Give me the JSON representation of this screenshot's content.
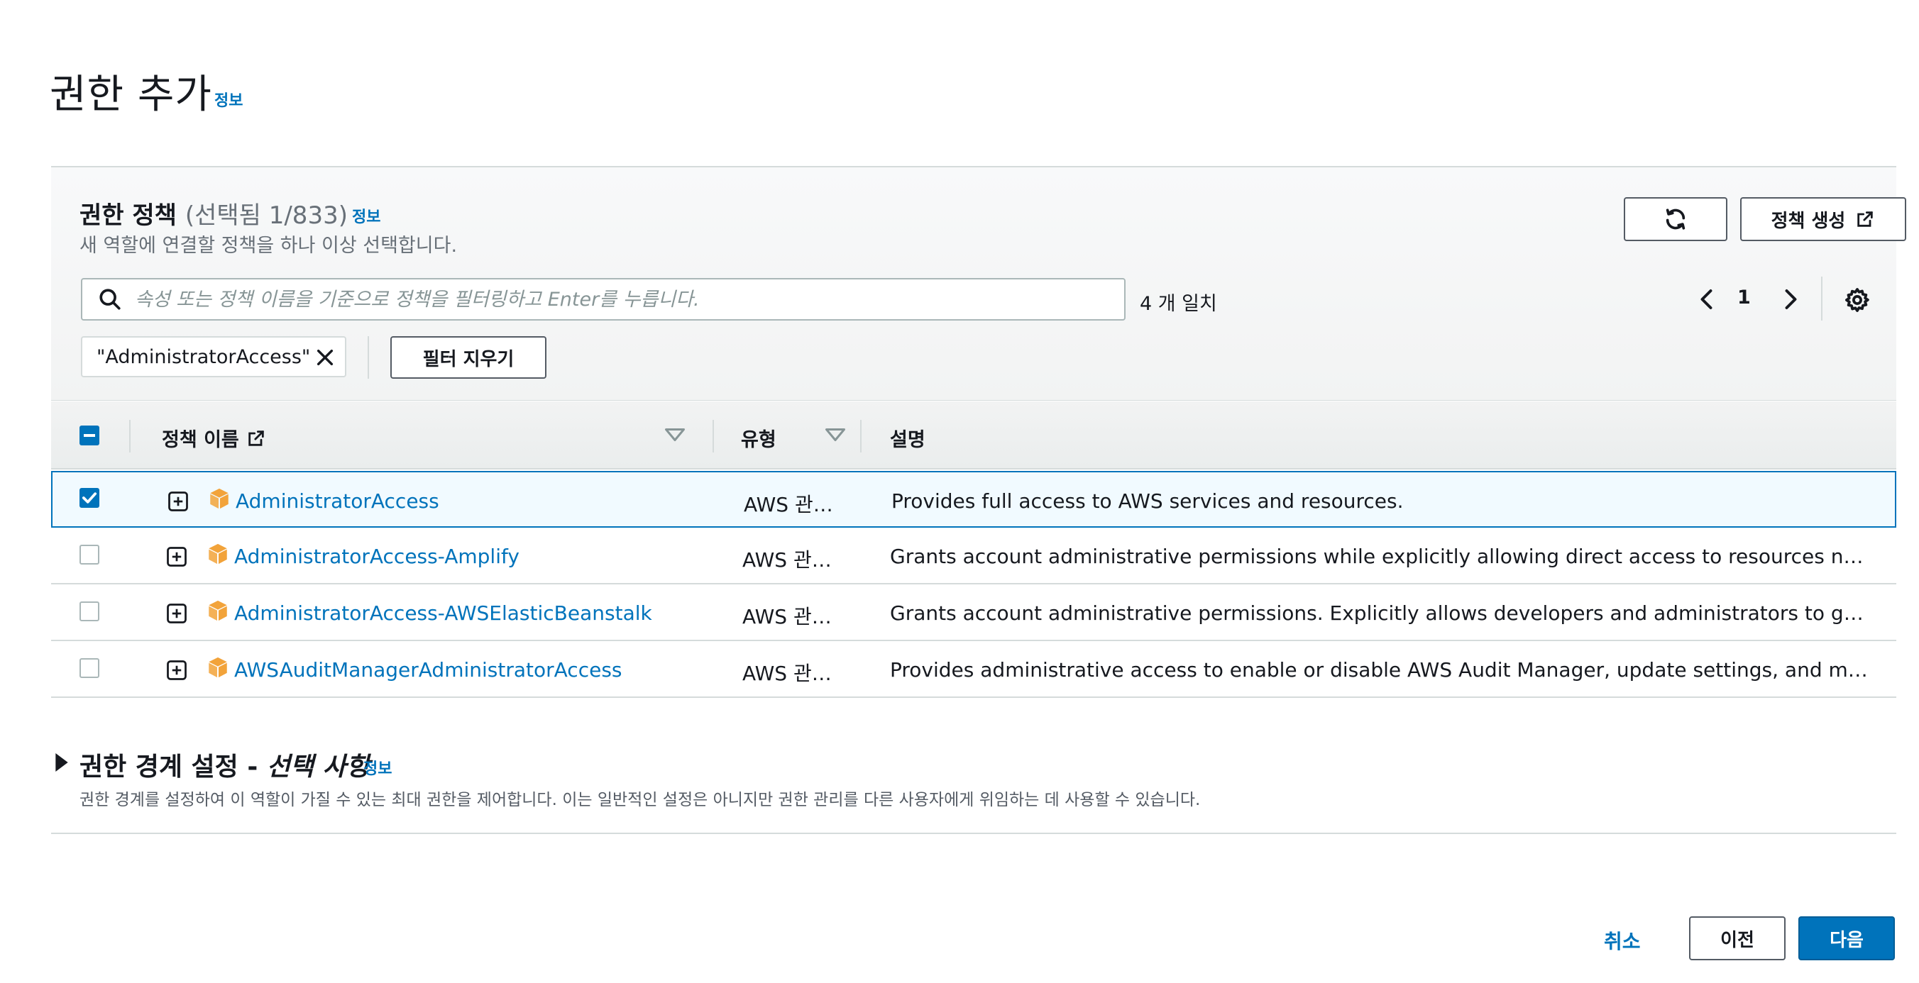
{
  "page": {
    "title": "권한 추가",
    "info_label": "정보"
  },
  "policies": {
    "title": "권한 정책",
    "count_label": "(선택됨 1/833)",
    "info_label": "정보",
    "description": "새 역할에 연결할 정책을 하나 이상 선택합니다.",
    "create_button": "정책 생성",
    "search_placeholder": "속성 또는 정책 이름을 기준으로 정책을 필터링하고 Enter를 누릅니다.",
    "match_count": "4 개 일치",
    "page_number": "1",
    "filter_token": "\"AdministratorAccess\"",
    "clear_filters": "필터 지우기",
    "columns": {
      "name": "정책 이름",
      "type": "유형",
      "description": "설명"
    },
    "rows": [
      {
        "name": "AdministratorAccess",
        "type": "AWS 관…",
        "description": "Provides full access to AWS services and resources.",
        "checked": true
      },
      {
        "name": "AdministratorAccess-Amplify",
        "type": "AWS 관…",
        "description": "Grants account administrative permissions while explicitly allowing direct access to resources needed by …",
        "checked": false
      },
      {
        "name": "AdministratorAccess-AWSElasticBeanstalk",
        "type": "AWS 관…",
        "description": "Grants account administrative permissions. Explicitly allows developers and administrators to gain direct a…",
        "checked": false
      },
      {
        "name": "AWSAuditManagerAdministratorAccess",
        "type": "AWS 관…",
        "description": "Provides administrative access to enable or disable AWS Audit Manager, update settings, and manage ass…",
        "checked": false
      }
    ]
  },
  "boundary": {
    "title": "권한 경계 설정 - ",
    "title_optional": "선택 사항",
    "info_label": "정보",
    "description": "권한 경계를 설정하여 이 역할이 가질 수 있는 최대 권한을 제어합니다. 이는 일반적인 설정은 아니지만 권한 관리를 다른 사용자에게 위임하는 데 사용할 수 있습니다."
  },
  "footer": {
    "cancel": "취소",
    "previous": "이전",
    "next": "다음"
  },
  "colors": {
    "link": "#0073bb",
    "primary_button": "#0073bb",
    "aws_box_icon": "#f2a33a"
  }
}
